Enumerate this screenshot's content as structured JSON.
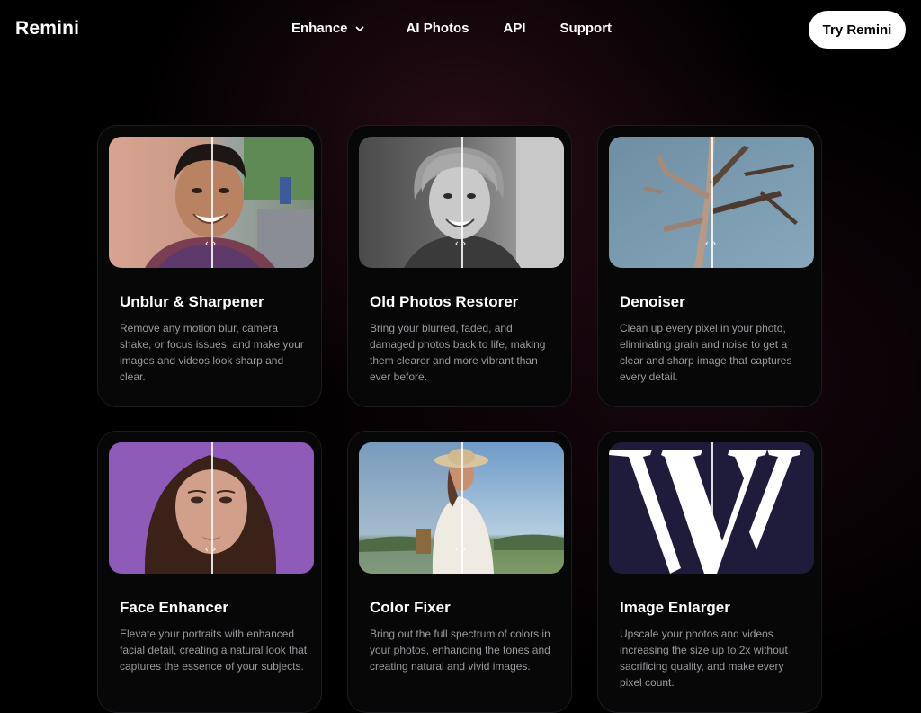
{
  "header": {
    "logo": "Remini",
    "nav": [
      {
        "label": "Enhance"
      },
      {
        "label": "AI Photos"
      },
      {
        "label": "API"
      },
      {
        "label": "Support"
      }
    ],
    "cta": "Try Remini"
  },
  "cards": [
    {
      "title": "Unblur & Sharpener",
      "description": "Remove any motion blur, camera shake, or focus issues, and make your images and videos look sharp and clear."
    },
    {
      "title": "Old Photos Restorer",
      "description": "Bring your blurred, faded, and damaged photos back to life, making them clearer and more vibrant than ever before."
    },
    {
      "title": "Denoiser",
      "description": "Clean up every pixel in your photo, eliminating grain and noise to get a clear and sharp image that captures every detail."
    },
    {
      "title": "Face Enhancer",
      "description": "Elevate your portraits with enhanced facial detail, creating a natural look that captures the essence of your subjects."
    },
    {
      "title": "Color Fixer",
      "description": "Bring out the full spectrum of colors in your photos, enhancing the tones and creating natural and vivid images."
    },
    {
      "title": "Image Enlarger",
      "description": "Upscale your photos and videos increasing the size up to 2x without sacrificing quality, and make every pixel count."
    }
  ],
  "colors": {
    "background": "#000000",
    "card_background": "#070708",
    "text_primary": "#ffffff",
    "text_secondary": "#9a9aa0",
    "cta_background": "#ffffff",
    "cta_text": "#000000"
  }
}
